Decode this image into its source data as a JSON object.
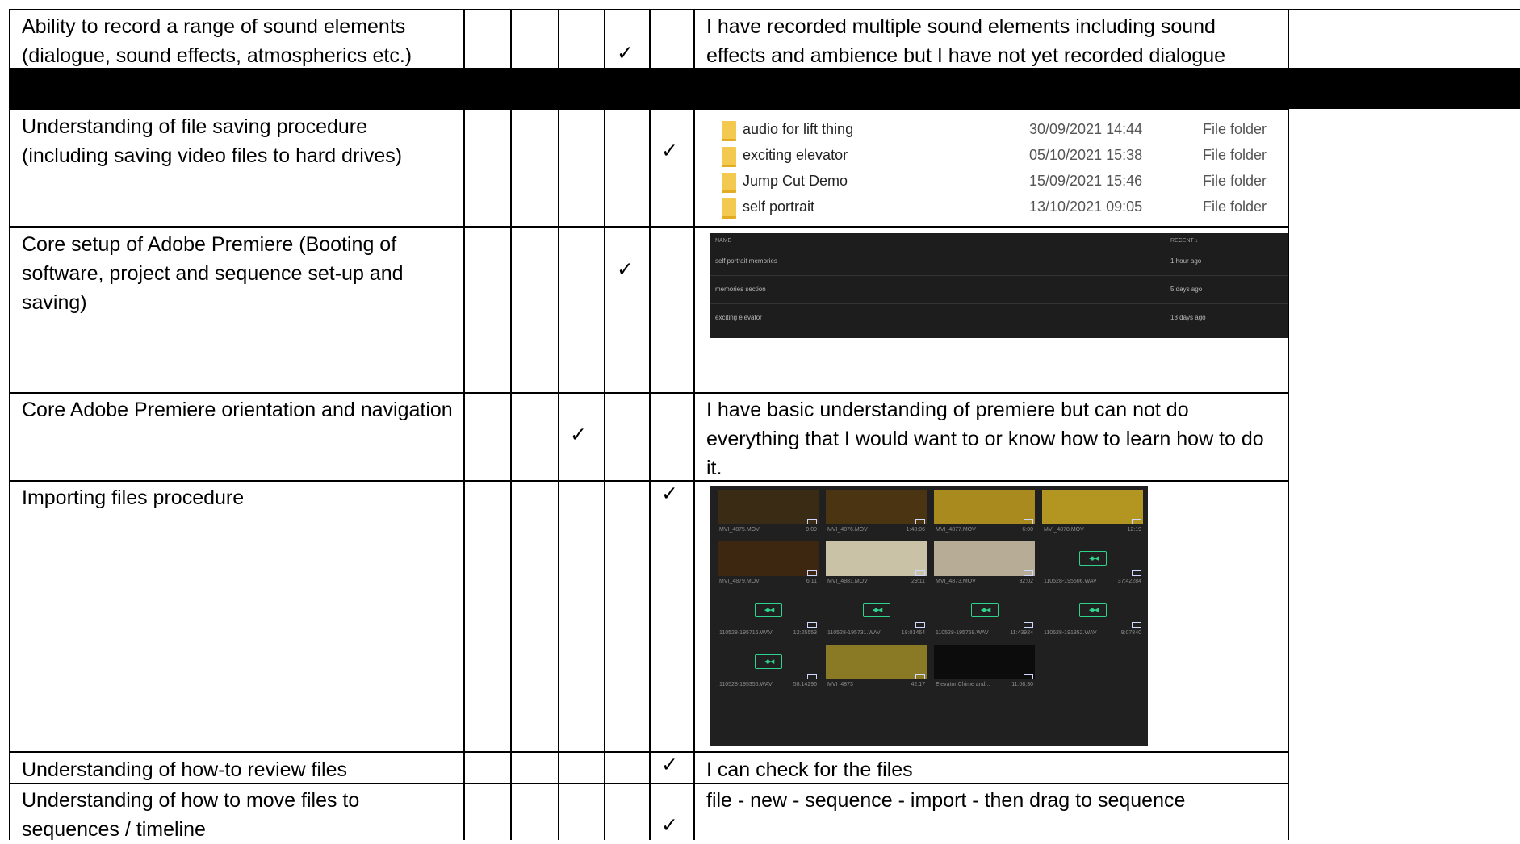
{
  "rows": [
    {
      "skill": "Ability to record a range of sound elements (dialogue, sound effects, atmospherics etc.)",
      "comment": "I have recorded multiple sound elements including sound effects and ambience but I have not yet recorded dialogue"
    },
    {
      "skill": "Understanding of file saving procedure (including saving video files to hard drives)"
    },
    {
      "skill": "Core setup of Adobe Premiere (Booting of software, project and sequence set-up and saving)"
    },
    {
      "skill": "Core Adobe Premiere orientation and navigation",
      "comment": "I have basic understanding of premiere but can not do everything that I would want to or know how to learn how to do it."
    },
    {
      "skill": "Importing files procedure"
    },
    {
      "skill": "Understanding of how-to review files",
      "comment": "I can check for the files"
    },
    {
      "skill": "Understanding of how to move files to sequences / timeline",
      "comment": "file - new - sequence - import - then drag to sequence"
    }
  ],
  "check_mark": "✓",
  "explorer_files": [
    {
      "name": "audio for lift thing",
      "date": "30/09/2021 14:44",
      "type": "File folder"
    },
    {
      "name": "exciting elevator",
      "date": "05/10/2021 15:38",
      "type": "File folder"
    },
    {
      "name": "Jump Cut Demo",
      "date": "15/09/2021 15:46",
      "type": "File folder"
    },
    {
      "name": "self portrait",
      "date": "13/10/2021 09:05",
      "type": "File folder"
    }
  ],
  "premiere_recent": {
    "name_header": "NAME",
    "recent_header": "RECENT ↓",
    "items": [
      {
        "name": "self portrait memories",
        "time": "1 hour ago"
      },
      {
        "name": "memories section",
        "time": "5 days ago"
      },
      {
        "name": "exciting elevator",
        "time": "13 days ago"
      }
    ]
  },
  "bin_items": [
    {
      "name": "MVI_4875.MOV",
      "duration": "9:09",
      "kind": "video",
      "color": "#3a2c14"
    },
    {
      "name": "MVI_4876.MOV",
      "duration": "1:48:06",
      "kind": "video",
      "color": "#4a3412"
    },
    {
      "name": "MVI_4877.MOV",
      "duration": "6:00",
      "kind": "video",
      "color": "#a98a1e"
    },
    {
      "name": "MVI_4878.MOV",
      "duration": "12:19",
      "kind": "video",
      "color": "#b39522"
    },
    {
      "name": "MVI_4879.MOV",
      "duration": "6:11",
      "kind": "video",
      "color": "#3d2710"
    },
    {
      "name": "MVI_4881.MOV",
      "duration": "29:11",
      "kind": "video",
      "color": "#c9c2a6"
    },
    {
      "name": "MVI_4873.MOV",
      "duration": "32:02",
      "kind": "video",
      "color": "#b7ad96"
    },
    {
      "name": "110528-195506.WAV",
      "duration": "37:42284",
      "kind": "audio"
    },
    {
      "name": "110528-195716.WAV",
      "duration": "12:25553",
      "kind": "audio"
    },
    {
      "name": "110528-195731.WAV",
      "duration": "18:01464",
      "kind": "audio"
    },
    {
      "name": "110528-195759.WAV",
      "duration": "11:43924",
      "kind": "audio"
    },
    {
      "name": "110528-191352.WAV",
      "duration": "9:07840",
      "kind": "audio"
    },
    {
      "name": "110528-195356.WAV",
      "duration": "58:14296",
      "kind": "audio"
    },
    {
      "name": "MVI_4873",
      "duration": "42:17",
      "kind": "video",
      "color": "#8a7a26"
    },
    {
      "name": "Elevator Chime and...",
      "duration": "11:08:30",
      "kind": "video",
      "color": "#0c0c0c"
    }
  ],
  "bin_wave_glyph": "◂▸◂"
}
